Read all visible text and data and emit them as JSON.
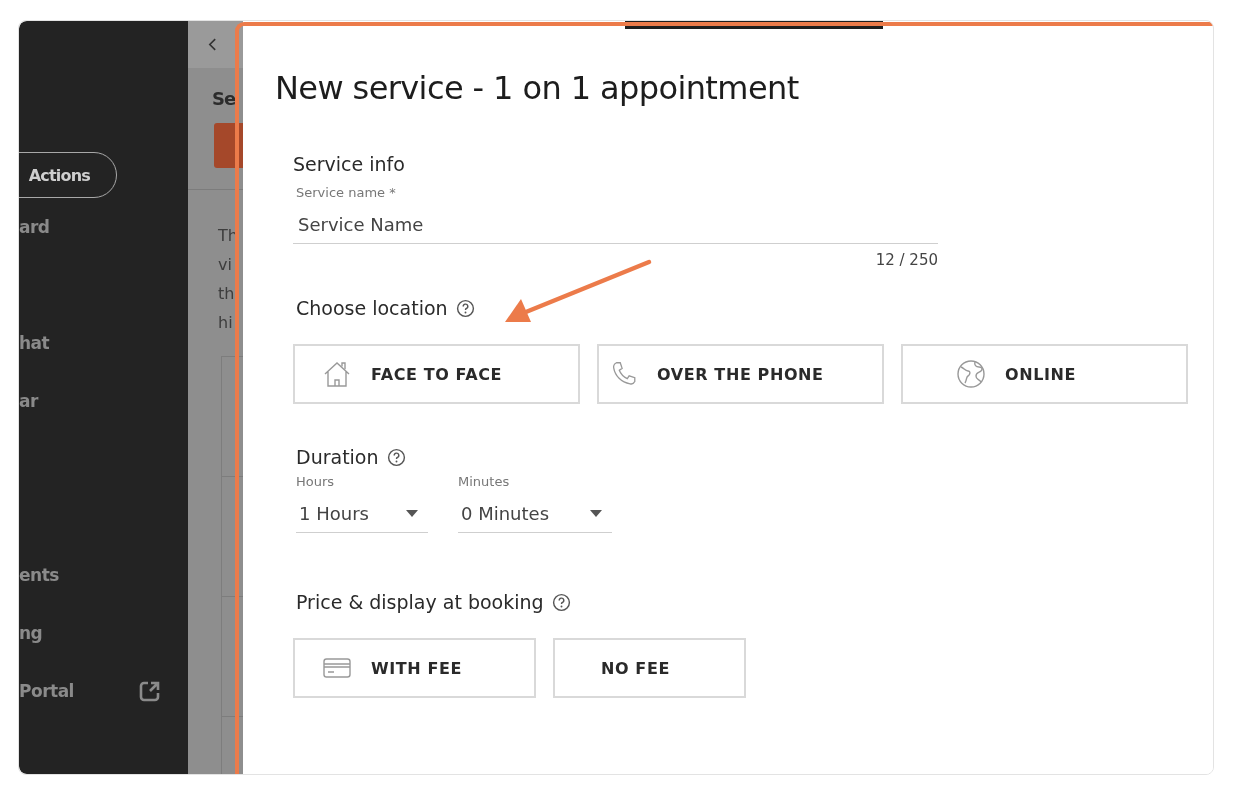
{
  "sidebar": {
    "items": [
      {
        "label": "Actions",
        "kind": "pill"
      },
      {
        "label": "ard",
        "kind": "item"
      },
      {
        "label": "hat",
        "kind": "item"
      },
      {
        "label": "ar",
        "kind": "item"
      },
      {
        "label": "ents",
        "kind": "item"
      },
      {
        "label": "ng",
        "kind": "item"
      },
      {
        "label": "Portal",
        "kind": "external"
      }
    ]
  },
  "background_page": {
    "heading": "Se",
    "paragraph_lines": [
      "Th",
      "vi",
      "th",
      "hi"
    ]
  },
  "modal": {
    "title": "New service - 1 on 1 appointment",
    "service_info": {
      "heading": "Service info",
      "label": "Service name *",
      "value": "Service Name",
      "counter": "12 / 250"
    },
    "location": {
      "heading": "Choose location",
      "options": [
        {
          "label": "FACE TO FACE",
          "kind": "house",
          "selected": false
        },
        {
          "label": "OVER THE PHONE",
          "kind": "phone",
          "selected": false
        },
        {
          "label": "ONLINE",
          "kind": "globe",
          "selected": false
        }
      ]
    },
    "duration": {
      "heading": "Duration",
      "fields": [
        {
          "label": "Hours",
          "value": "1 Hours"
        },
        {
          "label": "Minutes",
          "value": "0 Minutes"
        }
      ]
    },
    "price": {
      "heading": "Price & display at booking",
      "options": [
        {
          "label": "WITH FEE",
          "kind": "card",
          "selected": false
        },
        {
          "label": "NO FEE",
          "kind": "plain",
          "selected": false
        }
      ]
    }
  }
}
